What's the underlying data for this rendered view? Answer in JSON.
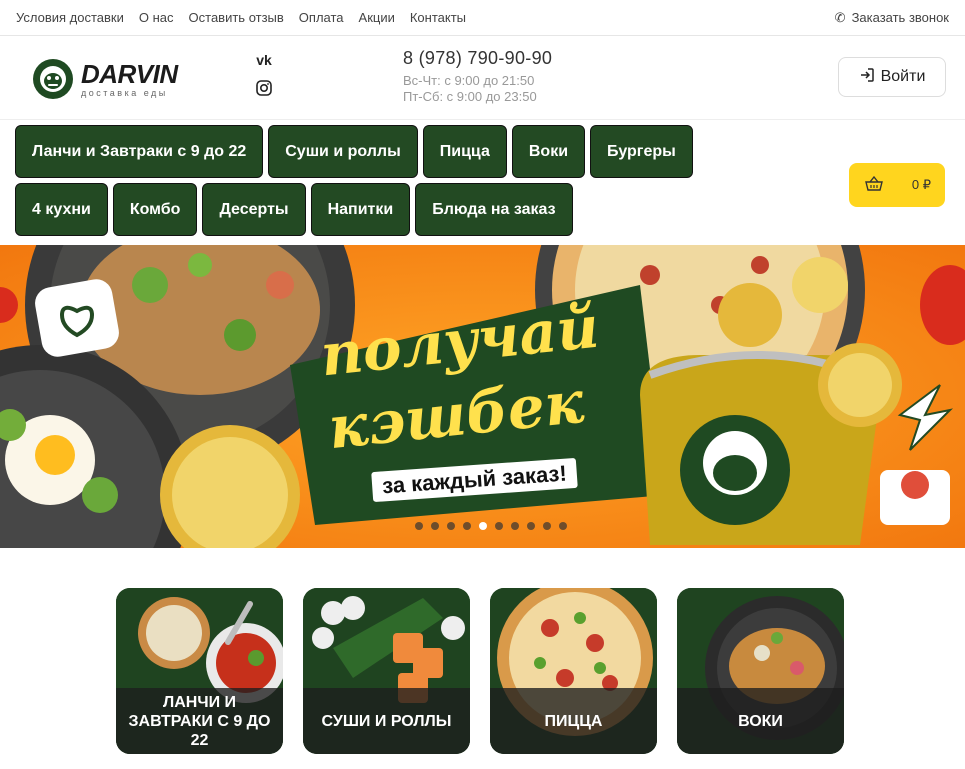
{
  "topbar": {
    "links": [
      "Условия доставки",
      "О нас",
      "Оставить отзыв",
      "Оплата",
      "Акции",
      "Контакты"
    ],
    "callback_label": "Заказать звонок"
  },
  "header": {
    "logo_name": "DARVIN",
    "logo_sub": "доставка еды",
    "social": [
      "vk-icon",
      "instagram-icon"
    ],
    "vk_label": "vk",
    "phone": "8 (978) 790-90-90",
    "hours_weekday": "Вс-Чт: с 9:00 до 21:50",
    "hours_weekend": "Пт-Сб: с 9:00 до 23:50",
    "login_label": "Войти"
  },
  "categories": [
    "Ланчи и Завтраки с 9 до 22",
    "Суши и роллы",
    "Пицца",
    "Воки",
    "Бургеры",
    "4 кухни",
    "Комбо",
    "Десерты",
    "Напитки",
    "Блюда на заказ"
  ],
  "cart": {
    "total": "0 ₽"
  },
  "banner": {
    "headline_1": "получай",
    "headline_2": "кэшбек",
    "subline": "за каждый заказ!",
    "slide_count": 10,
    "active_slide": 4
  },
  "cards": [
    {
      "label": "ЛАНЧИ И ЗАВТРАКИ С 9 ДО 22"
    },
    {
      "label": "СУШИ И РОЛЛЫ"
    },
    {
      "label": "ПИЦЦА"
    },
    {
      "label": "ВОКИ"
    }
  ],
  "colors": {
    "brand_green": "#234a23",
    "accent_yellow": "#ffd51e",
    "banner_orange": "#f7901e"
  }
}
